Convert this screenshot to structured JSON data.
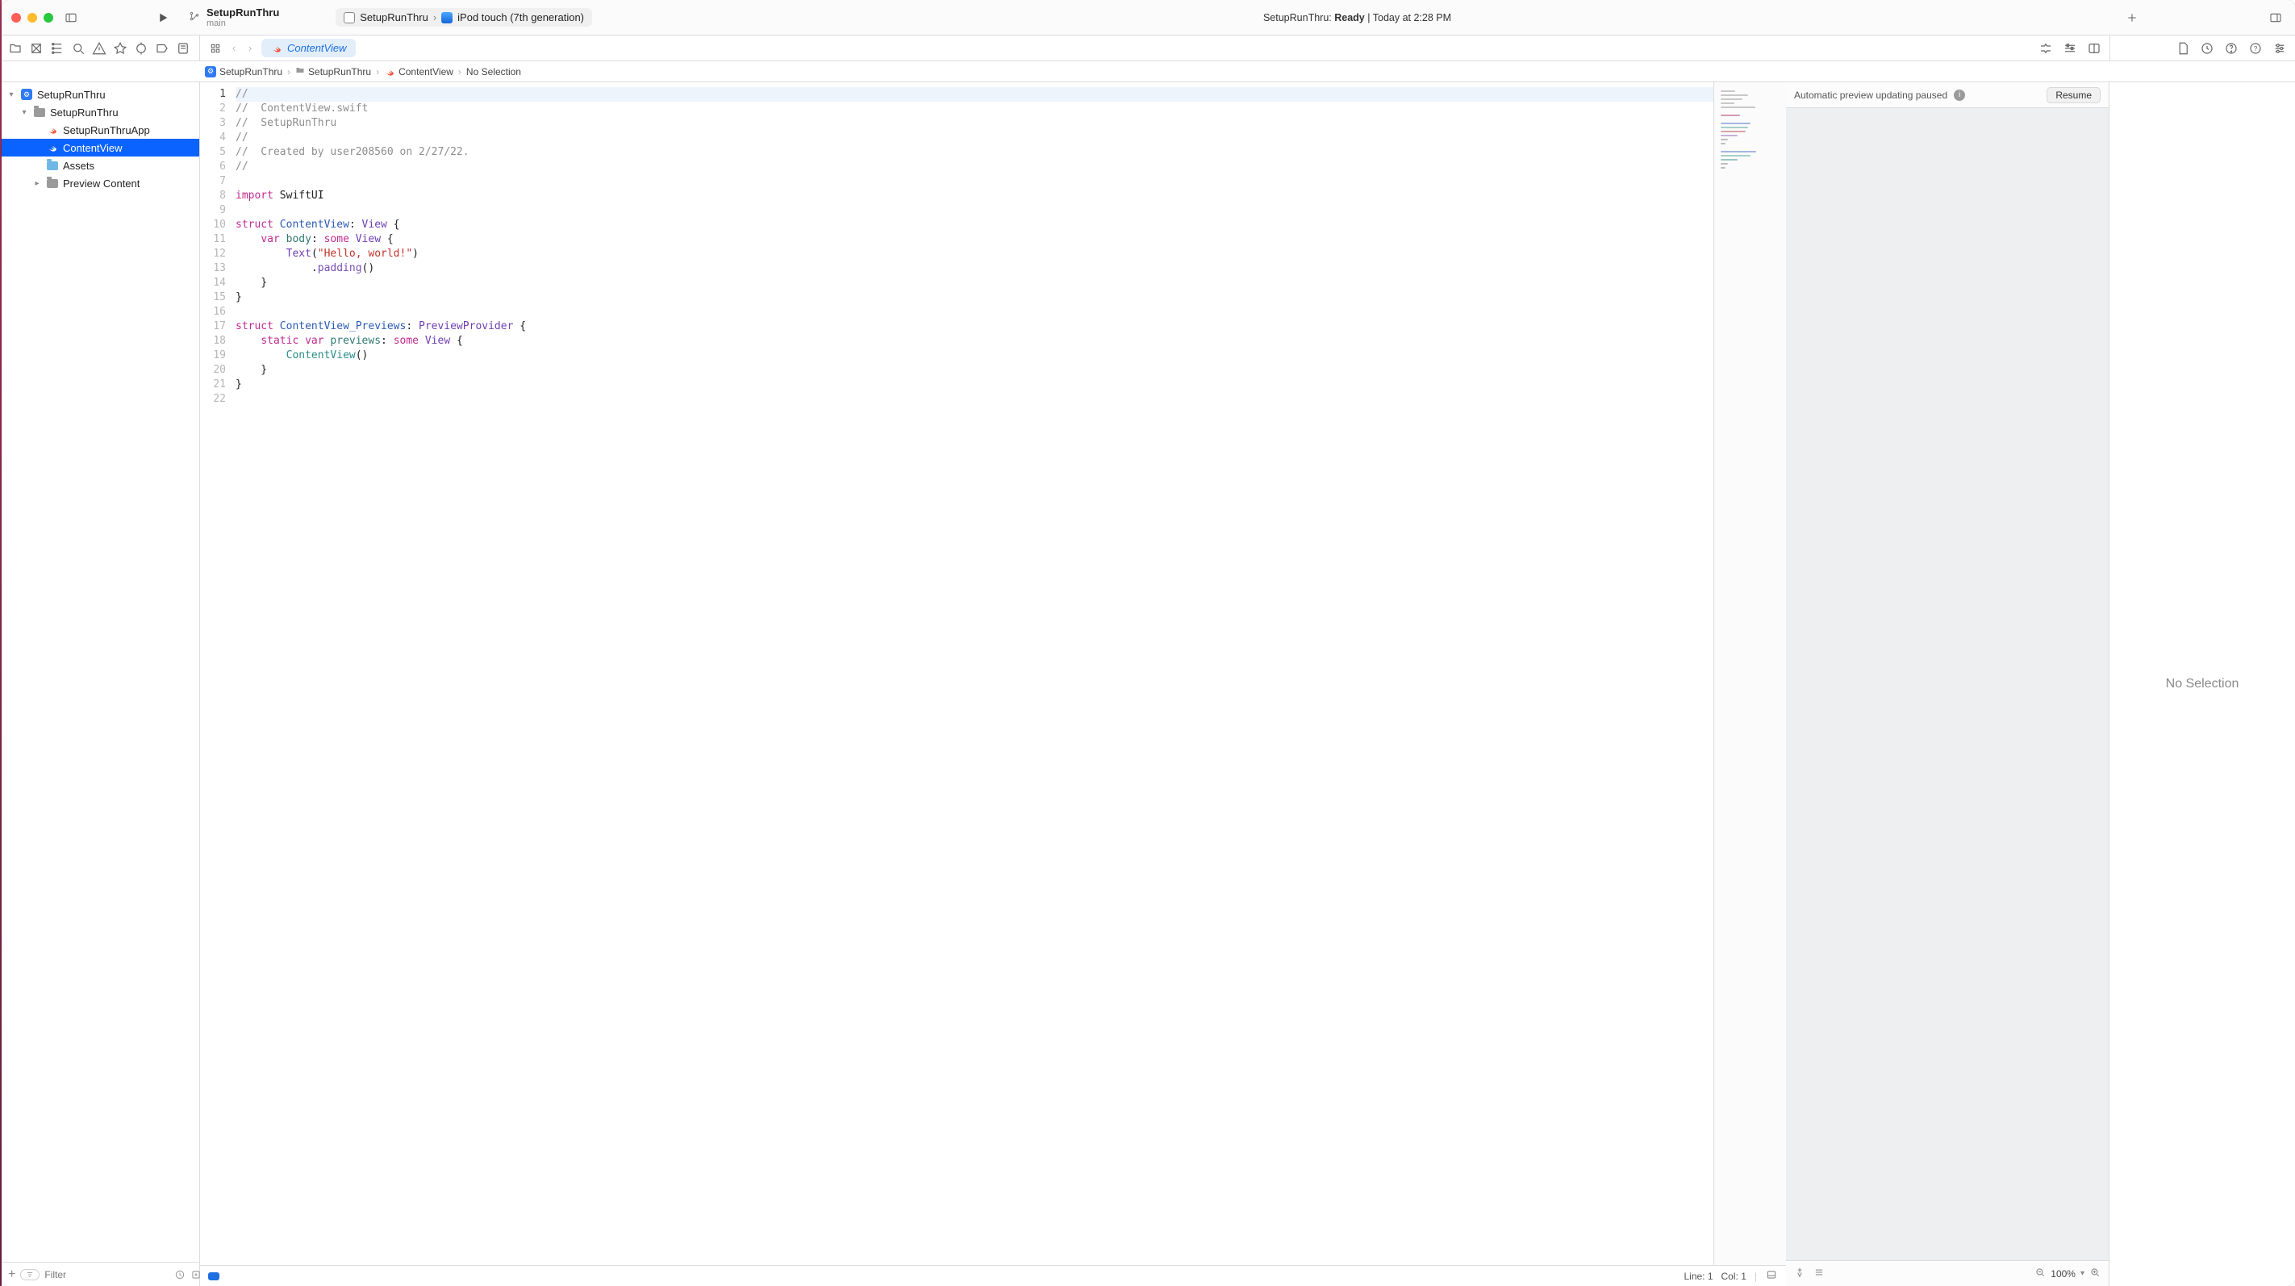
{
  "titlebar": {
    "project_name": "SetupRunThru",
    "branch": "main",
    "scheme_target": "SetupRunThru",
    "scheme_device": "iPod touch (7th generation)",
    "status_project": "SetupRunThru:",
    "status_state": "Ready",
    "status_sep": " | ",
    "status_time": "Today at 2:28 PM"
  },
  "tabbar": {
    "active_file": "ContentView"
  },
  "breadcrumb": {
    "segments": [
      "SetupRunThru",
      "SetupRunThru",
      "ContentView",
      "No Selection"
    ]
  },
  "navigator": {
    "items": [
      {
        "depth": 0,
        "kind": "project",
        "label": "SetupRunThru",
        "disclosed": true
      },
      {
        "depth": 1,
        "kind": "folder",
        "label": "SetupRunThru",
        "disclosed": true
      },
      {
        "depth": 2,
        "kind": "swift",
        "label": "SetupRunThruApp"
      },
      {
        "depth": 2,
        "kind": "swift",
        "label": "ContentView",
        "selected": true
      },
      {
        "depth": 2,
        "kind": "assets",
        "label": "Assets"
      },
      {
        "depth": 2,
        "kind": "folder",
        "label": "Preview Content",
        "disclosed": false,
        "hasChildren": true
      }
    ],
    "filter_placeholder": "Filter"
  },
  "code": {
    "lines": [
      {
        "n": 1,
        "html": "<span class='c-comment'>//</span>",
        "current": true
      },
      {
        "n": 2,
        "html": "<span class='c-comment'>//  ContentView.swift</span>"
      },
      {
        "n": 3,
        "html": "<span class='c-comment'>//  SetupRunThru</span>"
      },
      {
        "n": 4,
        "html": "<span class='c-comment'>//</span>"
      },
      {
        "n": 5,
        "html": "<span class='c-comment'>//  Created by user208560 on 2/27/22.</span>"
      },
      {
        "n": 6,
        "html": "<span class='c-comment'>//</span>"
      },
      {
        "n": 7,
        "html": ""
      },
      {
        "n": 8,
        "html": "<span class='c-kw-pink'>import</span> SwiftUI"
      },
      {
        "n": 9,
        "html": ""
      },
      {
        "n": 10,
        "html": "<span class='c-kw-pink'>struct</span> <span class='c-type'>ContentView</span>: <span class='c-kw-purple'>View</span> {"
      },
      {
        "n": 11,
        "html": "    <span class='c-kw-pink'>var</span> <span class='c-body'>body</span>: <span class='c-kw-pink'>some</span> <span class='c-kw-purple'>View</span> {"
      },
      {
        "n": 12,
        "html": "        <span class='c-kw-purple'>Text</span>(<span class='c-string'>\"Hello, world!\"</span>)"
      },
      {
        "n": 13,
        "html": "            .<span class='c-method'>padding</span>()"
      },
      {
        "n": 14,
        "html": "    }"
      },
      {
        "n": 15,
        "html": "}"
      },
      {
        "n": 16,
        "html": ""
      },
      {
        "n": 17,
        "html": "<span class='c-kw-pink'>struct</span> <span class='c-type'>ContentView_Previews</span>: <span class='c-kw-purple'>PreviewProvider</span> {"
      },
      {
        "n": 18,
        "html": "    <span class='c-kw-pink'>static</span> <span class='c-kw-pink'>var</span> <span class='c-body'>previews</span>: <span class='c-kw-pink'>some</span> <span class='c-kw-purple'>View</span> {"
      },
      {
        "n": 19,
        "html": "        <span class='c-ident'>ContentView</span>()"
      },
      {
        "n": 20,
        "html": "    }"
      },
      {
        "n": 21,
        "html": "}"
      },
      {
        "n": 22,
        "html": ""
      }
    ]
  },
  "preview": {
    "banner_msg": "Automatic preview updating paused",
    "resume_label": "Resume",
    "zoom_value": "100%"
  },
  "inspector": {
    "empty_text": "No Selection"
  },
  "status": {
    "line_label": "Line: 1",
    "col_label": "Col: 1"
  },
  "colors": {
    "selection": "#0a63ff",
    "swift_orange": "#f05138"
  }
}
